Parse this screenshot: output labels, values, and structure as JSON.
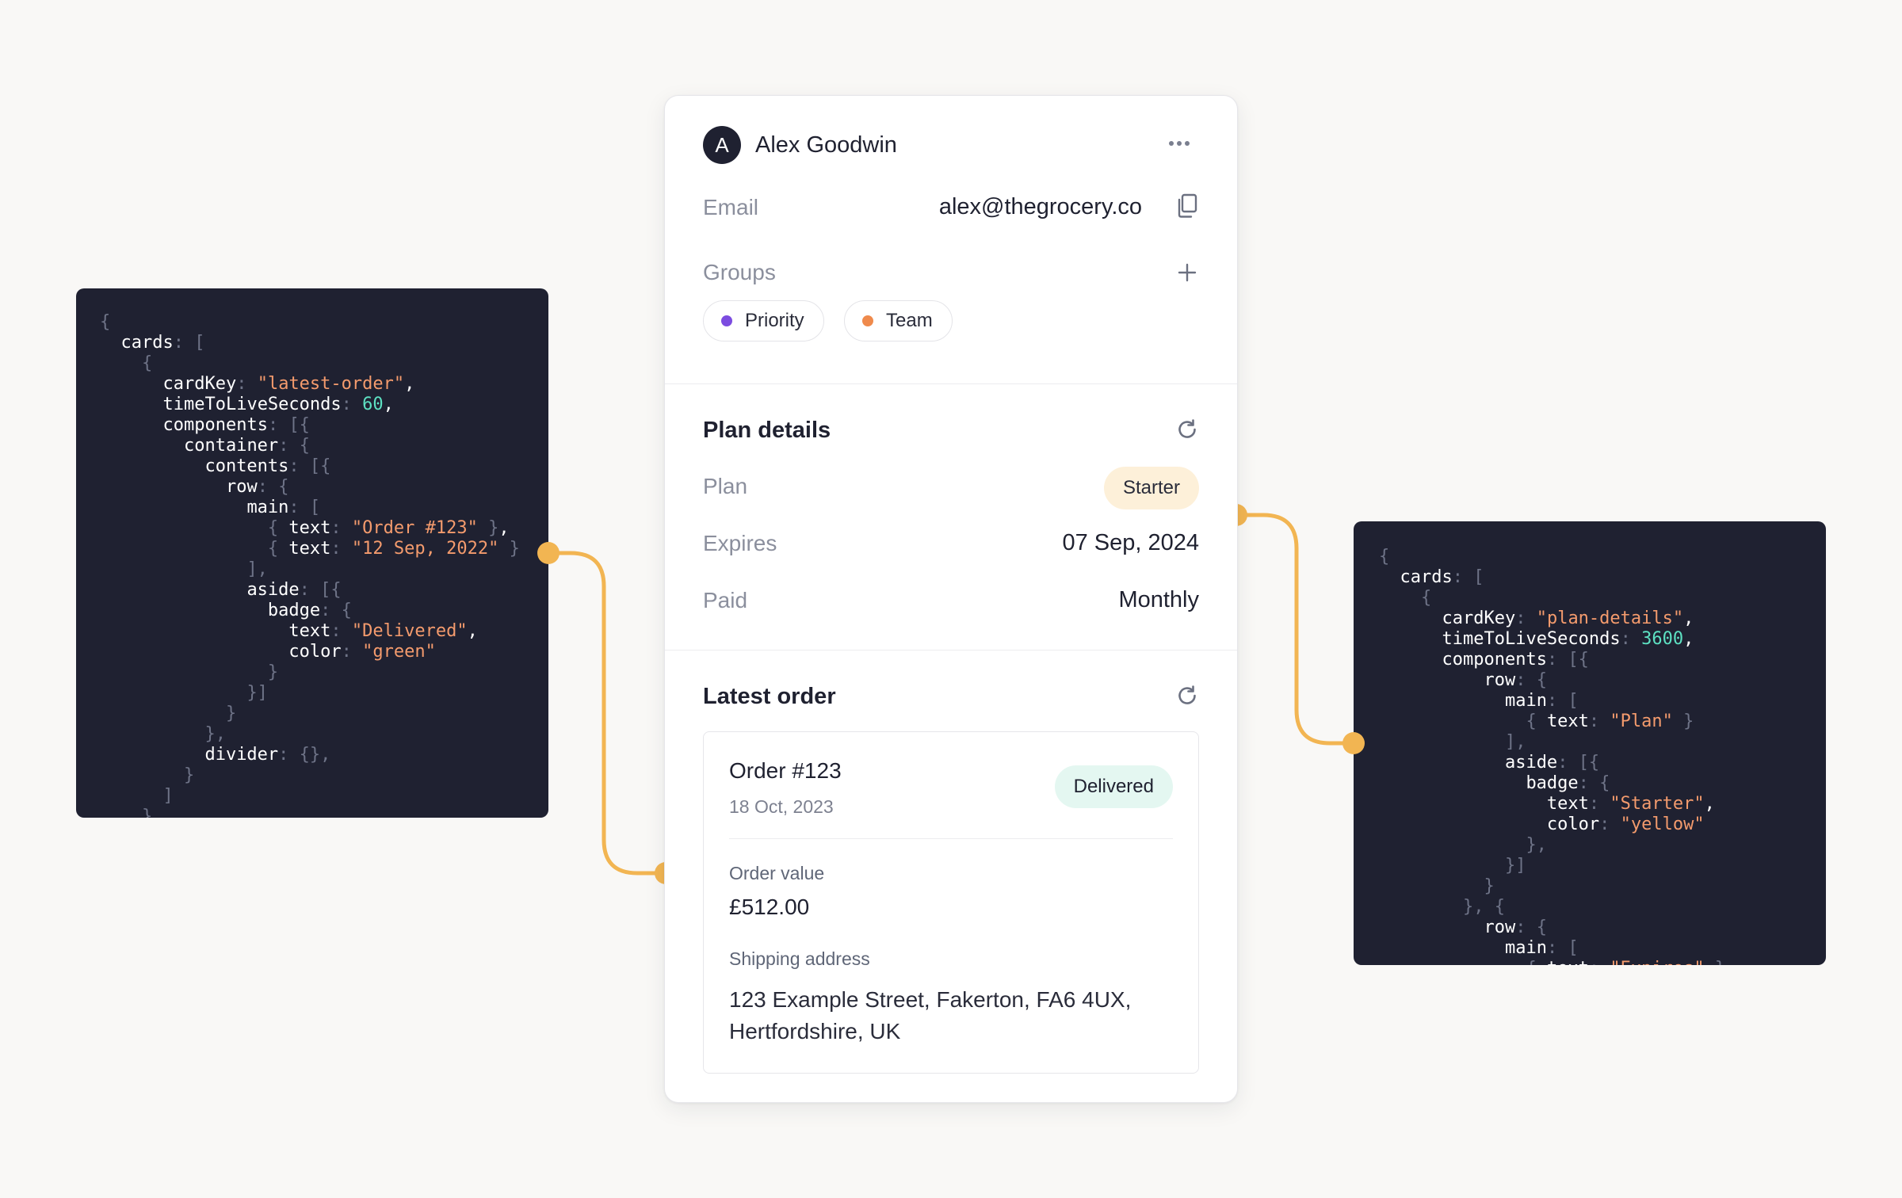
{
  "profile": {
    "avatar_initial": "A",
    "name": "Alex Goodwin",
    "email_label": "Email",
    "email_value": "alex@thegrocery.co",
    "groups_label": "Groups",
    "groups": [
      {
        "label": "Priority",
        "dot_color": "#7c4ce0"
      },
      {
        "label": "Team",
        "dot_color": "#ef8a4c"
      }
    ]
  },
  "plan_details": {
    "title": "Plan details",
    "plan_label": "Plan",
    "plan_value": "Starter",
    "plan_badge_color": "#fdf0d9",
    "expires_label": "Expires",
    "expires_value": "07 Sep, 2024",
    "paid_label": "Paid",
    "paid_value": "Monthly"
  },
  "latest_order": {
    "title": "Latest order",
    "order_title": "Order #123",
    "order_date": "18 Oct, 2023",
    "status": "Delivered",
    "status_badge_color": "#e4f7f1",
    "order_value_label": "Order value",
    "order_value": "£512.00",
    "shipping_label": "Shipping address",
    "shipping_address": "123 Example Street, Fakerton, FA6 4UX, Hertfordshire, UK"
  },
  "colors": {
    "connector": "#f2b552",
    "code_background": "#1f2131",
    "code_string": "#f49b6d",
    "code_number": "#5de1c2"
  },
  "code_left": [
    [
      [
        "p",
        "{"
      ]
    ],
    [
      [
        "s",
        "  "
      ],
      [
        "k",
        "cards"
      ],
      [
        "p",
        ": "
      ],
      [
        "p",
        "["
      ]
    ],
    [
      [
        "s",
        "    "
      ],
      [
        "p",
        "{"
      ]
    ],
    [
      [
        "s",
        "      "
      ],
      [
        "k",
        "cardKey"
      ],
      [
        "p",
        ": "
      ],
      [
        "str",
        "\"latest-order\""
      ],
      [
        "k",
        ","
      ]
    ],
    [
      [
        "s",
        "      "
      ],
      [
        "k",
        "timeToLiveSeconds"
      ],
      [
        "p",
        ": "
      ],
      [
        "n",
        "60"
      ],
      [
        "k",
        ","
      ]
    ],
    [
      [
        "s",
        "      "
      ],
      [
        "k",
        "components"
      ],
      [
        "p",
        ": "
      ],
      [
        "p",
        "[{"
      ]
    ],
    [
      [
        "s",
        "        "
      ],
      [
        "k",
        "container"
      ],
      [
        "p",
        ": "
      ],
      [
        "p",
        "{"
      ]
    ],
    [
      [
        "s",
        "          "
      ],
      [
        "k",
        "contents"
      ],
      [
        "p",
        ": "
      ],
      [
        "p",
        "[{"
      ]
    ],
    [
      [
        "s",
        "            "
      ],
      [
        "k",
        "row"
      ],
      [
        "p",
        ": "
      ],
      [
        "p",
        "{"
      ]
    ],
    [
      [
        "s",
        "              "
      ],
      [
        "k",
        "main"
      ],
      [
        "p",
        ": "
      ],
      [
        "p",
        "["
      ]
    ],
    [
      [
        "s",
        "                "
      ],
      [
        "p",
        "{ "
      ],
      [
        "k",
        "text"
      ],
      [
        "p",
        ": "
      ],
      [
        "str",
        "\"Order #123\""
      ],
      [
        "p",
        " }"
      ],
      [
        "k",
        ","
      ]
    ],
    [
      [
        "s",
        "                "
      ],
      [
        "p",
        "{ "
      ],
      [
        "k",
        "text"
      ],
      [
        "p",
        ": "
      ],
      [
        "str",
        "\"12 Sep, 2022\""
      ],
      [
        "p",
        " }"
      ]
    ],
    [
      [
        "s",
        "              "
      ],
      [
        "p",
        "],"
      ]
    ],
    [
      [
        "s",
        "              "
      ],
      [
        "k",
        "aside"
      ],
      [
        "p",
        ": "
      ],
      [
        "p",
        "[{"
      ]
    ],
    [
      [
        "s",
        "                "
      ],
      [
        "k",
        "badge"
      ],
      [
        "p",
        ": "
      ],
      [
        "p",
        "{"
      ]
    ],
    [
      [
        "s",
        "                  "
      ],
      [
        "k",
        "text"
      ],
      [
        "p",
        ": "
      ],
      [
        "str",
        "\"Delivered\""
      ],
      [
        "k",
        ","
      ]
    ],
    [
      [
        "s",
        "                  "
      ],
      [
        "k",
        "color"
      ],
      [
        "p",
        ": "
      ],
      [
        "str",
        "\"green\""
      ]
    ],
    [
      [
        "s",
        "                "
      ],
      [
        "p",
        "}"
      ]
    ],
    [
      [
        "s",
        "              "
      ],
      [
        "p",
        "}]"
      ]
    ],
    [
      [
        "s",
        "            "
      ],
      [
        "p",
        "}"
      ]
    ],
    [
      [
        "s",
        "          "
      ],
      [
        "p",
        "},"
      ]
    ],
    [
      [
        "s",
        "          "
      ],
      [
        "k",
        "divider"
      ],
      [
        "p",
        ": "
      ],
      [
        "p",
        "{},"
      ]
    ],
    [
      [
        "s",
        "        "
      ],
      [
        "p",
        "}"
      ]
    ],
    [
      [
        "s",
        "      "
      ],
      [
        "p",
        "]"
      ]
    ],
    [
      [
        "s",
        "    "
      ],
      [
        "p",
        "}"
      ]
    ]
  ],
  "code_right": [
    [
      [
        "p",
        "{"
      ]
    ],
    [
      [
        "s",
        "  "
      ],
      [
        "k",
        "cards"
      ],
      [
        "p",
        ": "
      ],
      [
        "p",
        "["
      ]
    ],
    [
      [
        "s",
        "    "
      ],
      [
        "p",
        "{"
      ]
    ],
    [
      [
        "s",
        "      "
      ],
      [
        "k",
        "cardKey"
      ],
      [
        "p",
        ": "
      ],
      [
        "str",
        "\"plan-details\""
      ],
      [
        "k",
        ","
      ]
    ],
    [
      [
        "s",
        "      "
      ],
      [
        "k",
        "timeToLiveSeconds"
      ],
      [
        "p",
        ": "
      ],
      [
        "n",
        "3600"
      ],
      [
        "k",
        ","
      ]
    ],
    [
      [
        "s",
        "      "
      ],
      [
        "k",
        "components"
      ],
      [
        "p",
        ": "
      ],
      [
        "p",
        "[{"
      ]
    ],
    [
      [
        "s",
        "          "
      ],
      [
        "k",
        "row"
      ],
      [
        "p",
        ": "
      ],
      [
        "p",
        "{"
      ]
    ],
    [
      [
        "s",
        "            "
      ],
      [
        "k",
        "main"
      ],
      [
        "p",
        ": "
      ],
      [
        "p",
        "["
      ]
    ],
    [
      [
        "s",
        "              "
      ],
      [
        "p",
        "{ "
      ],
      [
        "k",
        "text"
      ],
      [
        "p",
        ": "
      ],
      [
        "str",
        "\"Plan\""
      ],
      [
        "p",
        " }"
      ]
    ],
    [
      [
        "s",
        "            "
      ],
      [
        "p",
        "],"
      ]
    ],
    [
      [
        "s",
        "            "
      ],
      [
        "k",
        "aside"
      ],
      [
        "p",
        ": "
      ],
      [
        "p",
        "[{"
      ]
    ],
    [
      [
        "s",
        "              "
      ],
      [
        "k",
        "badge"
      ],
      [
        "p",
        ": "
      ],
      [
        "p",
        "{"
      ]
    ],
    [
      [
        "s",
        "                "
      ],
      [
        "k",
        "text"
      ],
      [
        "p",
        ": "
      ],
      [
        "str",
        "\"Starter\""
      ],
      [
        "k",
        ","
      ]
    ],
    [
      [
        "s",
        "                "
      ],
      [
        "k",
        "color"
      ],
      [
        "p",
        ": "
      ],
      [
        "str",
        "\"yellow\""
      ]
    ],
    [
      [
        "s",
        "              "
      ],
      [
        "p",
        "},"
      ]
    ],
    [
      [
        "s",
        "            "
      ],
      [
        "p",
        "}]"
      ]
    ],
    [
      [
        "s",
        "          "
      ],
      [
        "p",
        "}"
      ]
    ],
    [
      [
        "s",
        "        "
      ],
      [
        "p",
        "}, {"
      ]
    ],
    [
      [
        "s",
        "          "
      ],
      [
        "k",
        "row"
      ],
      [
        "p",
        ": "
      ],
      [
        "p",
        "{"
      ]
    ],
    [
      [
        "s",
        "            "
      ],
      [
        "k",
        "main"
      ],
      [
        "p",
        ": "
      ],
      [
        "p",
        "["
      ]
    ],
    [
      [
        "s",
        "              "
      ],
      [
        "p",
        "{ "
      ],
      [
        "k",
        "text"
      ],
      [
        "p",
        ": "
      ],
      [
        "str",
        "\"Expires\""
      ],
      [
        "p",
        " }"
      ]
    ]
  ]
}
